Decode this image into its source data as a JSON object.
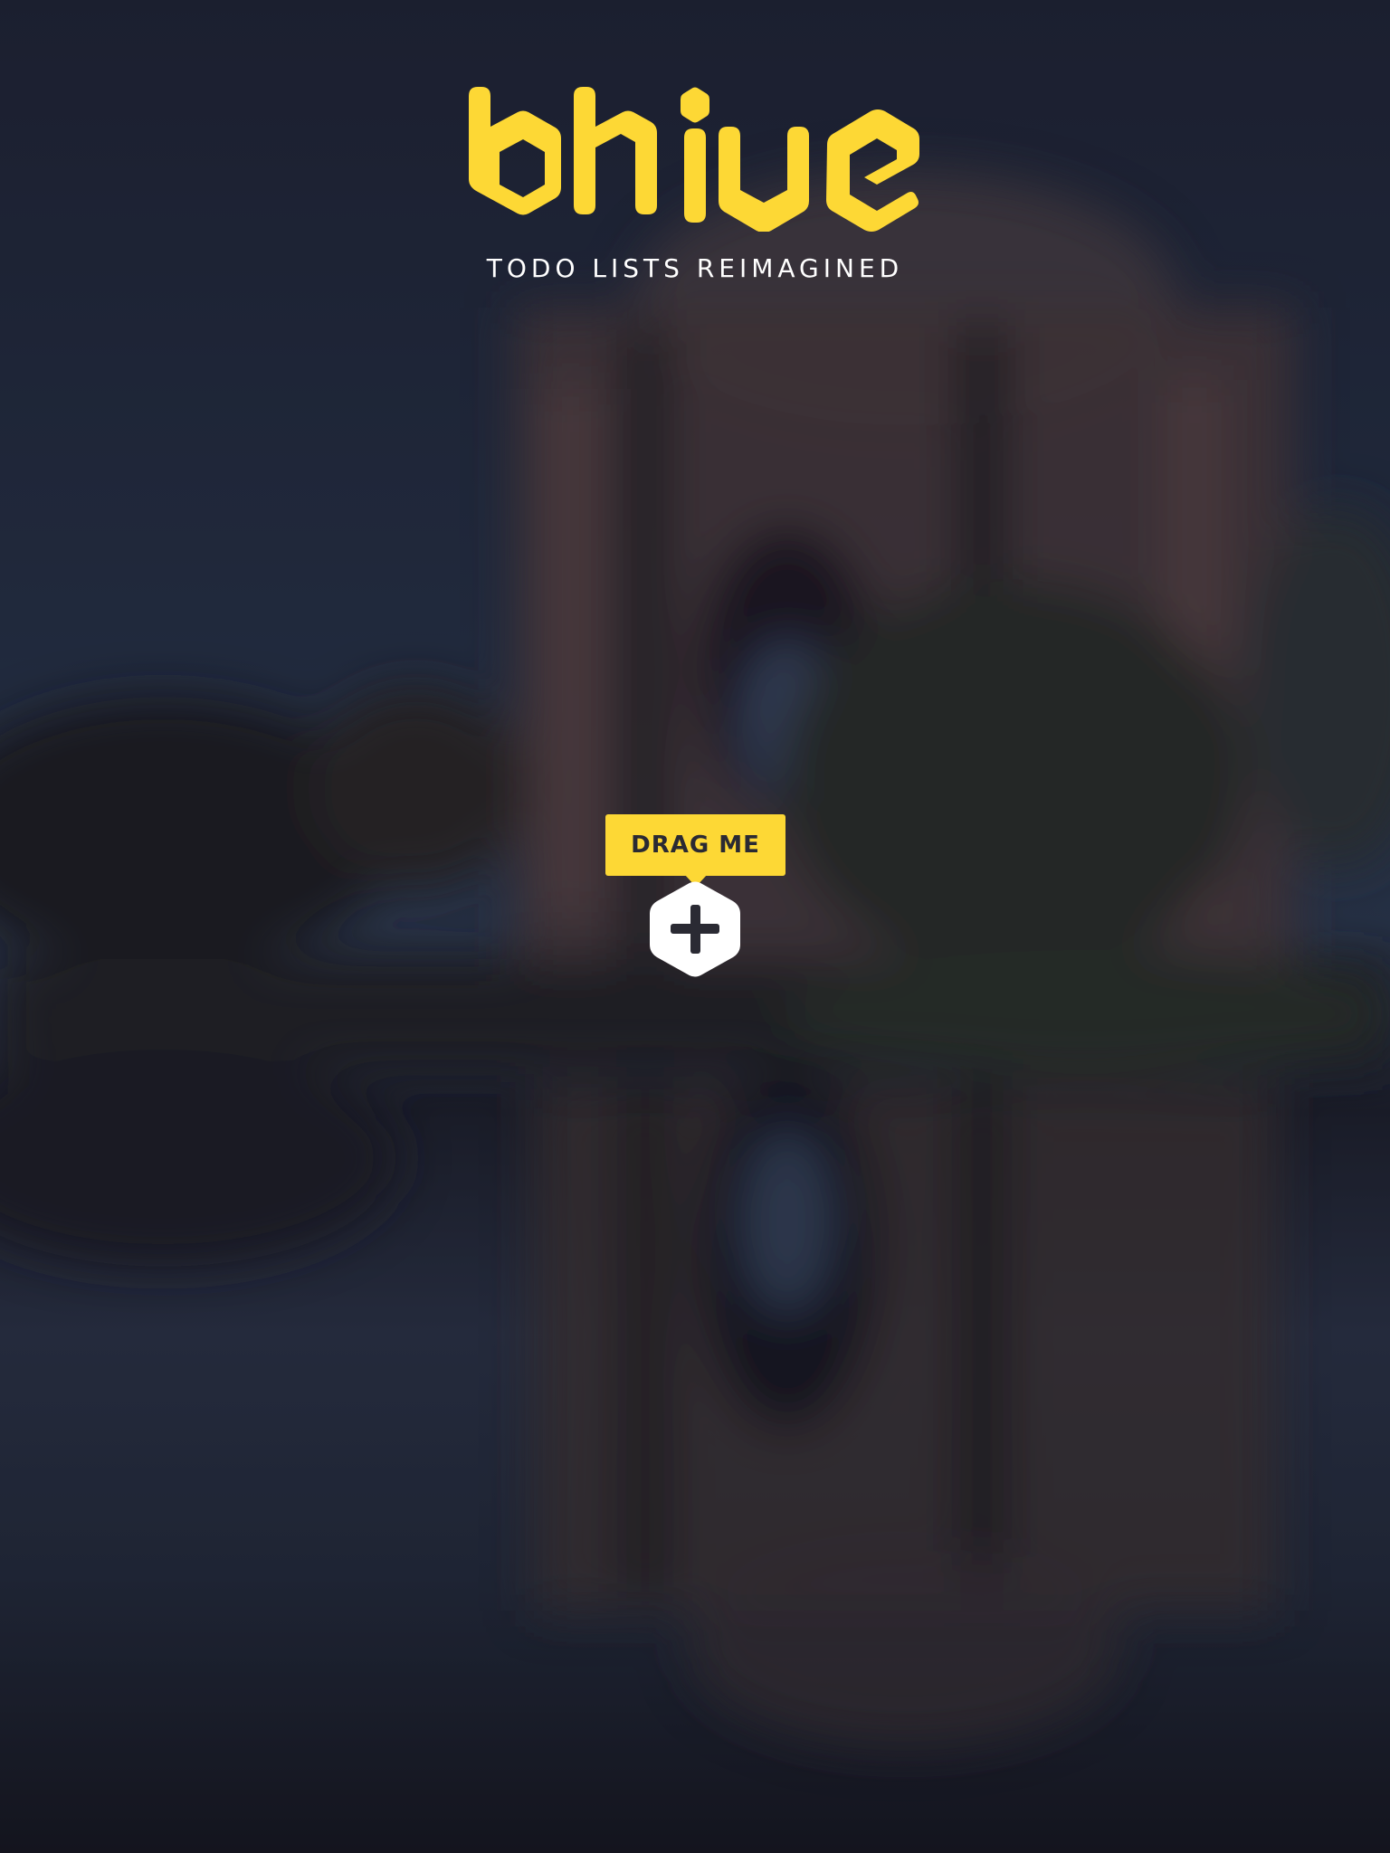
{
  "app": {
    "logo_text": "bhive",
    "tagline": "TODO LISTS REIMAGINED"
  },
  "drag_handle": {
    "tooltip_label": "DRAG ME",
    "icon": "plus-icon"
  },
  "colors": {
    "brand_yellow": "#fdd835",
    "dark_text": "#2a2a33",
    "background": "#1c2133",
    "hex_fill": "#ffffff"
  }
}
